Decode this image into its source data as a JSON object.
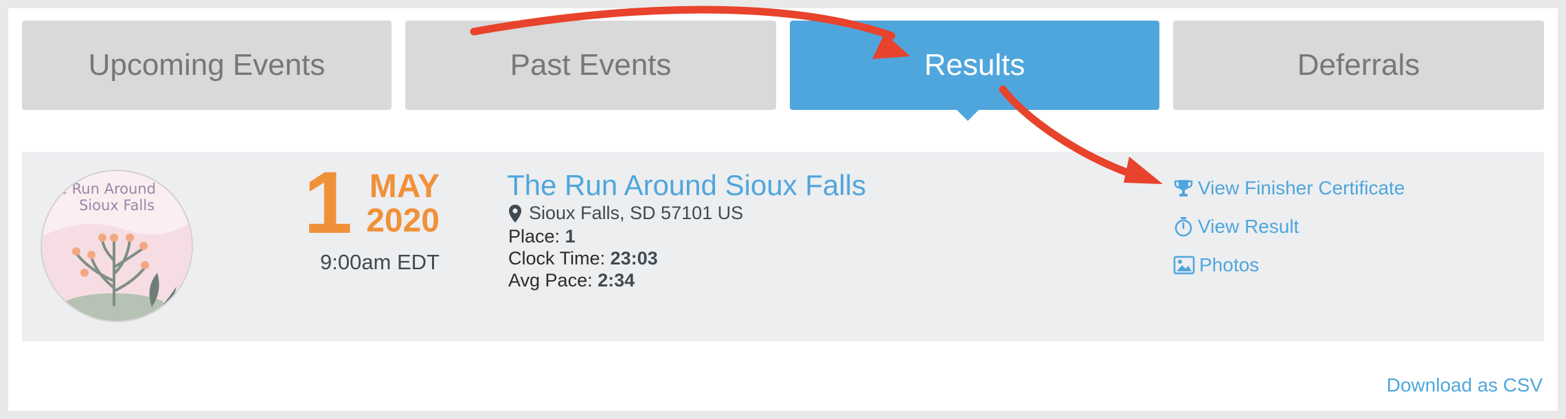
{
  "tabs": [
    {
      "label": "Upcoming Events",
      "active": false
    },
    {
      "label": "Past Events",
      "active": false
    },
    {
      "label": "Results",
      "active": true
    },
    {
      "label": "Deferrals",
      "active": false
    }
  ],
  "event": {
    "logo_text_line1": "e Run Around",
    "logo_text_line2": "Sioux Falls",
    "day": "1",
    "month": "MAY",
    "year": "2020",
    "time": "9:00am EDT",
    "title": "The Run Around Sioux Falls",
    "location": "Sioux Falls, SD 57101 US",
    "stats": [
      {
        "label": "Place:",
        "value": "1"
      },
      {
        "label": "Clock Time:",
        "value": "23:03"
      },
      {
        "label": "Avg Pace:",
        "value": "2:34"
      }
    ]
  },
  "actions": [
    {
      "label": "View Finisher Certificate",
      "icon": "trophy-icon"
    },
    {
      "label": "View Result",
      "icon": "stopwatch-icon"
    },
    {
      "label": "Photos",
      "icon": "photo-icon"
    }
  ],
  "footer": {
    "download_label": "Download as CSV"
  },
  "colors": {
    "accent": "#4fa6dc",
    "date": "#f0913a",
    "annotation_arrow": "#e8432c",
    "tab_inactive": "#d9d9d9"
  }
}
